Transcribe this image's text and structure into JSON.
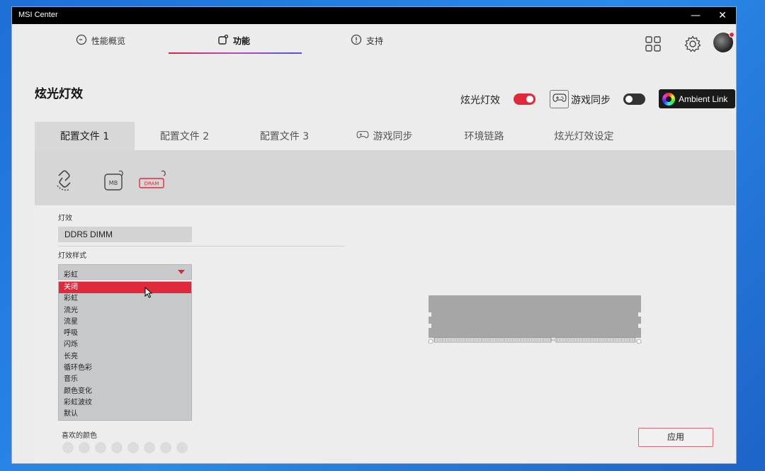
{
  "window": {
    "title": "MSI Center",
    "min_glyph": "—",
    "close_glyph": "✕"
  },
  "topnav": {
    "tabs": [
      {
        "label": "性能概览",
        "icon": "gauge-icon"
      },
      {
        "label": "功能",
        "icon": "feature-icon"
      },
      {
        "label": "支持",
        "icon": "support-icon"
      }
    ],
    "active_index": 1,
    "right_icons": [
      "grid-icon",
      "gear-icon",
      "avatar"
    ]
  },
  "page": {
    "title": "炫光灯效",
    "rgb_toggle_label": "炫光灯效",
    "rgb_toggle_on": true,
    "game_sync_label": "游戏同步",
    "game_sync_on": false,
    "ambient_link_label": "Ambient Link"
  },
  "subtabs": {
    "items": [
      "配置文件 1",
      "配置文件 2",
      "配置文件 3",
      "游戏同步",
      "环境链路",
      "炫光灯效设定"
    ],
    "active_index": 0
  },
  "devices": [
    {
      "name": "link-icon"
    },
    {
      "name": "mb-icon",
      "label": "MB"
    },
    {
      "name": "dram-icon",
      "label": "DRAM"
    }
  ],
  "effect": {
    "section_label": "灯效",
    "device_value": "DDR5 DIMM",
    "style_label": "灯效样式",
    "selected_value": "彩虹",
    "options": [
      "关闭",
      "彩虹",
      "流光",
      "流星",
      "呼吸",
      "闪烁",
      "长亮",
      "循环色彩",
      "音乐",
      "颜色变化",
      "彩虹波纹",
      "默认"
    ],
    "highlighted_index": 0,
    "favorite_colors_label": "喜欢的颜色",
    "favorite_colors": [
      "#dcdcdc",
      "#dcdcdc",
      "#dcdcdc",
      "#dcdcdc",
      "#dcdcdc",
      "#dcdcdc",
      "#dcdcdc",
      "#dcdcdc"
    ]
  },
  "apply_label": "应用",
  "colors": {
    "accent": "#e02a3c",
    "active_tab_bg": "#d8d8d8",
    "dram_bar": "#a6a6a6"
  }
}
